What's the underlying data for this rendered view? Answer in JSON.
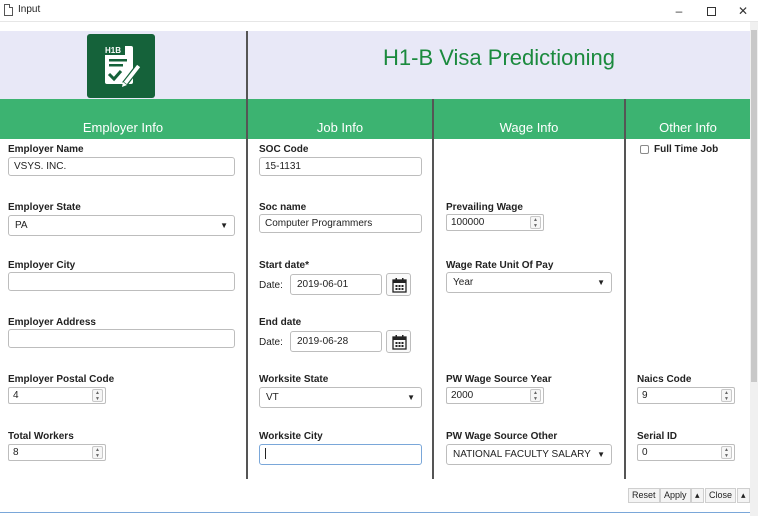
{
  "window": {
    "title": "Input",
    "minimize": "–",
    "close": "✕"
  },
  "header": {
    "app_title": "H1-B Visa Predictioning",
    "logo_text": "H1B"
  },
  "sections": {
    "employer": "Employer Info",
    "job": "Job Info",
    "wage": "Wage Info",
    "other": "Other Info"
  },
  "employer": {
    "name_label": "Employer Name",
    "name_value": "VSYS. INC.",
    "state_label": "Employer State",
    "state_value": "PA",
    "city_label": "Employer City",
    "city_value": "",
    "address_label": "Employer Address",
    "address_value": "",
    "postal_label": "Employer Postal Code",
    "postal_value": "4",
    "workers_label": "Total Workers",
    "workers_value": "8"
  },
  "job": {
    "soc_code_label": "SOC Code",
    "soc_code_value": "15-1131",
    "soc_name_label": "Soc name",
    "soc_name_value": "Computer Programmers",
    "start_label": "Start date*",
    "date_prefix": "Date:",
    "start_value": "2019-06-01",
    "end_label": "End date",
    "end_value": "2019-06-28",
    "worksite_state_label": "Worksite State",
    "worksite_state_value": "VT",
    "worksite_city_label": "Worksite City",
    "worksite_city_value": ""
  },
  "wage": {
    "prevailing_label": "Prevailing Wage",
    "prevailing_value": "100000",
    "unit_label": "Wage Rate Unit Of Pay",
    "unit_value": "Year",
    "source_year_label": "PW Wage Source Year",
    "source_year_value": "2000",
    "source_other_label": "PW Wage Source Other",
    "source_other_value": "NATIONAL FACULTY SALARY"
  },
  "other": {
    "full_time_label": "Full Time Job",
    "full_time_checked": false,
    "naics_label": "Naics Code",
    "naics_value": "9",
    "serial_label": "Serial ID",
    "serial_value": "0"
  },
  "toolbar": {
    "reset": "Reset",
    "apply": "Apply",
    "collapse": "▴",
    "close": "Close",
    "expand": "▴"
  },
  "colors": {
    "section_bar": "#3cb371",
    "header_bg": "#e8e8f7",
    "title_green": "#1b8a3e",
    "logo_bg": "#15623a"
  },
  "icons": {
    "calendar": "calendar-icon",
    "document": "document-icon",
    "logo": "h1b-form-pen-icon"
  }
}
